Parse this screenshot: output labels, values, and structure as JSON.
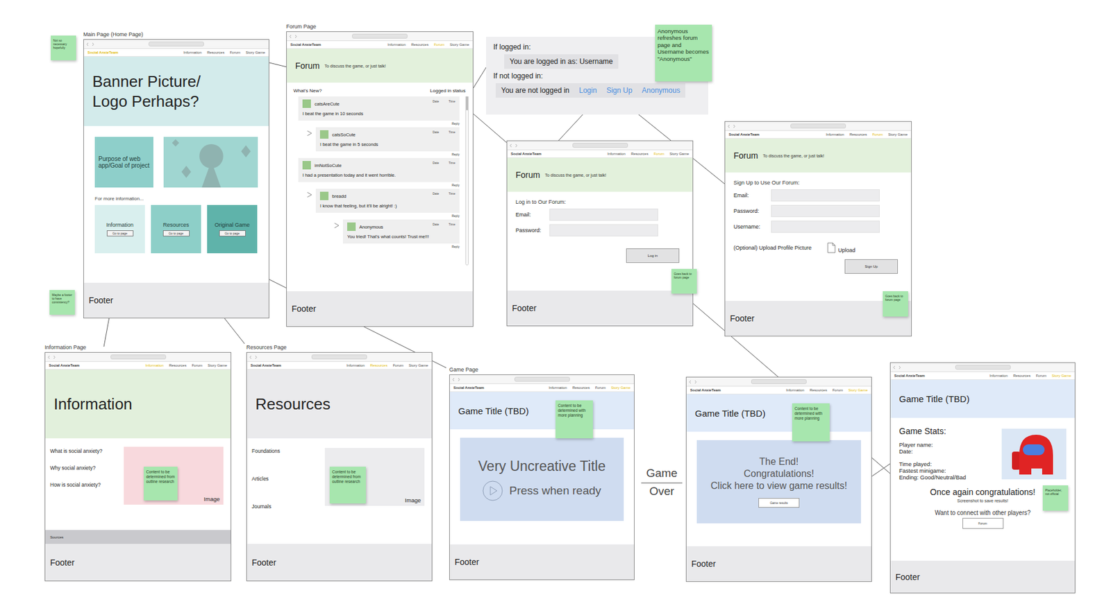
{
  "brand": "Social AnxieTeam",
  "pages": {
    "home": {
      "label": "Main Page (Home Page)",
      "brand_selected": true,
      "nav": [
        {
          "label": "Information",
          "selected": false
        },
        {
          "label": "Resources",
          "selected": false
        },
        {
          "label": "Forum",
          "selected": false
        },
        {
          "label": "Story Game",
          "selected": false
        }
      ],
      "banner": "Banner Picture/ Logo Perhaps?",
      "purpose": "Purpose of web app/Goal of project",
      "more": "For more information...",
      "cards": [
        {
          "title": "Information",
          "button": "Go to page"
        },
        {
          "title": "Resources",
          "button": "Go to page"
        },
        {
          "title": "Original Game",
          "button": "Go to page"
        }
      ],
      "footer": "Footer"
    },
    "forum": {
      "label": "Forum Page",
      "brand_selected": false,
      "nav": [
        {
          "label": "Information",
          "selected": false
        },
        {
          "label": "Resources",
          "selected": false
        },
        {
          "label": "Forum",
          "selected": true
        },
        {
          "label": "Story Game",
          "selected": false
        }
      ],
      "title": "Forum",
      "subtitle": "To discuss the game, or just talk!",
      "whats_new": "What's New?",
      "status": "Logged in status",
      "posts": [
        {
          "user": "catsAreCute",
          "date": "Date",
          "time": "Time",
          "text": "I beat the game in 10 seconds",
          "reply": "Reply",
          "depth": 0
        },
        {
          "user": "catsSoCute",
          "date": "Date",
          "time": "Time",
          "text": "I beat the game in 5 seconds",
          "reply": "Reply",
          "depth": 1
        },
        {
          "user": "imNotSoCute",
          "date": "Date",
          "time": "Time",
          "text": "I had a presentation today and it went horrible.",
          "reply": "Reply",
          "depth": 0
        },
        {
          "user": "breadd",
          "date": "Date",
          "time": "Time",
          "text": "I know that feeling, but it'll be alright! :)",
          "reply": "Reply",
          "depth": 1
        },
        {
          "user": "Anonymous",
          "date": "Date",
          "time": "Time",
          "text": "You tried! That's what counts! Trust me!!!",
          "reply": "Reply",
          "depth": 2
        }
      ],
      "footer": "Footer"
    },
    "login": {
      "brand_selected": false,
      "nav": [
        {
          "label": "Information",
          "selected": false
        },
        {
          "label": "Resources",
          "selected": false
        },
        {
          "label": "Forum",
          "selected": true
        },
        {
          "label": "Story Game",
          "selected": false
        }
      ],
      "title": "Forum",
      "subtitle": "To discuss the game, or just talk!",
      "heading": "Log in to Our Forum:",
      "fields": [
        "Email:",
        "Password:"
      ],
      "button": "Log in",
      "note": "Goes back to forum page",
      "footer": "Footer"
    },
    "signup": {
      "brand_selected": false,
      "nav": [
        {
          "label": "Information",
          "selected": false
        },
        {
          "label": "Resources",
          "selected": false
        },
        {
          "label": "Forum",
          "selected": true
        },
        {
          "label": "Story Game",
          "selected": false
        }
      ],
      "title": "Forum",
      "subtitle": "To discuss the game, or just talk!",
      "heading": "Sign Up to Use Our Forum:",
      "fields": [
        "Email:",
        "Password:",
        "Username:"
      ],
      "upload_label": "(Optional) Upload Profile Picture",
      "upload": "Upload",
      "button": "Sign Up",
      "note": "Goes back to forum page",
      "footer": "Footer"
    },
    "information": {
      "label": "Information Page",
      "brand_selected": false,
      "nav": [
        {
          "label": "Information",
          "selected": true
        },
        {
          "label": "Resources",
          "selected": false
        },
        {
          "label": "Forum",
          "selected": false
        },
        {
          "label": "Story Game",
          "selected": false
        }
      ],
      "title": "Information",
      "questions": [
        "What is social anxiety?",
        "Why social anxiety?",
        "How is social anxiety?"
      ],
      "image": "Image",
      "note": "Content to be determined from outline research",
      "sources": "Sources",
      "footer": "Footer"
    },
    "resources": {
      "label": "Resources Page",
      "brand_selected": false,
      "nav": [
        {
          "label": "Information",
          "selected": false
        },
        {
          "label": "Resources",
          "selected": true
        },
        {
          "label": "Forum",
          "selected": false
        },
        {
          "label": "Story Game",
          "selected": false
        }
      ],
      "title": "Resources",
      "items": [
        "Foundations",
        "Articles",
        "Journals"
      ],
      "image": "Image",
      "note": "Content to be determined from outline research",
      "footer": "Footer"
    },
    "game": {
      "label": "Game Page",
      "brand_selected": false,
      "nav": [
        {
          "label": "Information",
          "selected": false
        },
        {
          "label": "Resources",
          "selected": false
        },
        {
          "label": "Forum",
          "selected": false
        },
        {
          "label": "Story Game",
          "selected": true
        }
      ],
      "title": "Game Title (TBD)",
      "note": "Content to be determined with more planning",
      "game_title": "Very Uncreative Title",
      "start": "Press when ready",
      "footer": "Footer"
    },
    "game_end": {
      "brand_selected": false,
      "nav": [
        {
          "label": "Information",
          "selected": false
        },
        {
          "label": "Resources",
          "selected": false
        },
        {
          "label": "Forum",
          "selected": false
        },
        {
          "label": "Story Game",
          "selected": true
        }
      ],
      "title": "Game Title (TBD)",
      "note": "Content to be determined with more planning",
      "lines": [
        "The End!",
        "Congratulations!",
        "Click here to view game results!"
      ],
      "button": "Game results",
      "footer": "Footer"
    },
    "results": {
      "brand_selected": false,
      "nav": [
        {
          "label": "Information",
          "selected": false
        },
        {
          "label": "Resources",
          "selected": false
        },
        {
          "label": "Forum",
          "selected": false
        },
        {
          "label": "Story Game",
          "selected": true
        }
      ],
      "title": "Game Title (TBD)",
      "stats_title": "Game Stats:",
      "stats": [
        [
          "Player name:",
          "Date:"
        ],
        [
          "Time played:",
          "Fastest minigame:",
          "Ending: Good/Neutral/Bad"
        ]
      ],
      "note": "Placeholder, not official",
      "congrats": "Once again congratulations!",
      "screenshot": "Screenshot to save results!",
      "connect": "Want to connect with other players?",
      "button": "Forum",
      "footer": "Footer"
    }
  },
  "login_status": {
    "logged_in_label": "If logged in:",
    "logged_in_text": "You are logged in as: Username",
    "not_logged_label": "If not logged in:",
    "not_logged_text": "You are not logged in",
    "links": [
      "Login",
      "Sign Up",
      "Anonymous"
    ]
  },
  "anon_note": "Anonymous refreshes forum page and Username becomes \"Anonymous\"",
  "notes": [
    "Not so necessary hopefully",
    "Maybe a footer to have consistency?"
  ],
  "game_over": "Game Over"
}
